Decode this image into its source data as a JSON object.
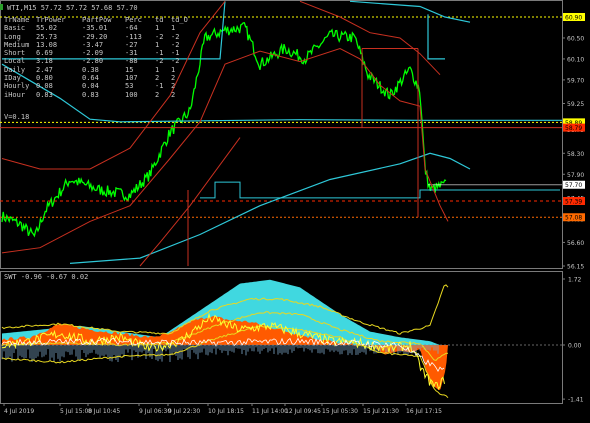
{
  "main_chart": {
    "title": "WTI,M15  57.72 57.72 57.68 57.70",
    "v_label": "V=0.18",
    "table_headers": [
      "TrName",
      "TrPower",
      "PartPow",
      "Perc",
      "td",
      "td_O"
    ],
    "table_rows": [
      [
        "Basic",
        "55.02",
        "-35.01",
        "-64",
        "1",
        "1"
      ],
      [
        "Long",
        "25.73",
        "-29.20",
        "-113",
        "-2",
        "-2"
      ],
      [
        "Medium",
        "13.08",
        "-3.47",
        "-27",
        "1",
        "-2"
      ],
      [
        "Short",
        "6.69",
        "-2.09",
        "-31",
        "-1",
        "-1"
      ],
      [
        "Local",
        "3.18",
        "-2.80",
        "-88",
        "-2",
        "-2"
      ],
      [
        "Daily",
        "2.47",
        "0.38",
        "15",
        "1",
        "1"
      ],
      [
        "IDay",
        "0.80",
        "0.64",
        "107",
        "2",
        "2"
      ],
      [
        "Hourly",
        "0.08",
        "0.04",
        "53",
        "-1",
        "2"
      ],
      [
        "iHour",
        "0.83",
        "0.83",
        "100",
        "2",
        "2"
      ]
    ],
    "price_labels": [
      "60.90",
      "60.50",
      "60.10",
      "59.70",
      "59.25",
      "58.75",
      "58.30",
      "57.90",
      "57.45",
      "57.05",
      "56.60",
      "56.15"
    ],
    "marker_labels": [
      {
        "text": "60.90",
        "bg": "#ffff00"
      },
      {
        "text": "58.89",
        "bg": "#ffff00"
      },
      {
        "text": "58.79",
        "bg": "#ff2a00"
      },
      {
        "text": "57.70",
        "bg": "#ffffff"
      },
      {
        "text": "57.39",
        "bg": "#ff2a00"
      },
      {
        "text": "57.08",
        "bg": "#ff6a00"
      }
    ]
  },
  "sub_chart": {
    "title": "SWT -0.96 -0.67 0.02",
    "levels": [
      "1.72",
      "0.00",
      "-1.41"
    ]
  },
  "time_labels": [
    "4 Jul 2019",
    "5 Jul 15:00",
    "8 Jul 10:45",
    "9 Jul 06:30",
    "9 Jul 22:30",
    "10 Jul 18:15",
    "11 Jul 14:00",
    "12 Jul 09:45",
    "15 Jul 05:30",
    "15 Jul 21:30",
    "16 Jul 17:15"
  ],
  "colors": {
    "price": "#00ff00",
    "channel_cyan": "#2ec8d8",
    "channel_red": "#c83020",
    "level_yellow": "#ffff00",
    "osc_orange": "#ff5a00",
    "osc_cyan": "#40d8e0",
    "osc_yellow": "#e8d820"
  }
}
